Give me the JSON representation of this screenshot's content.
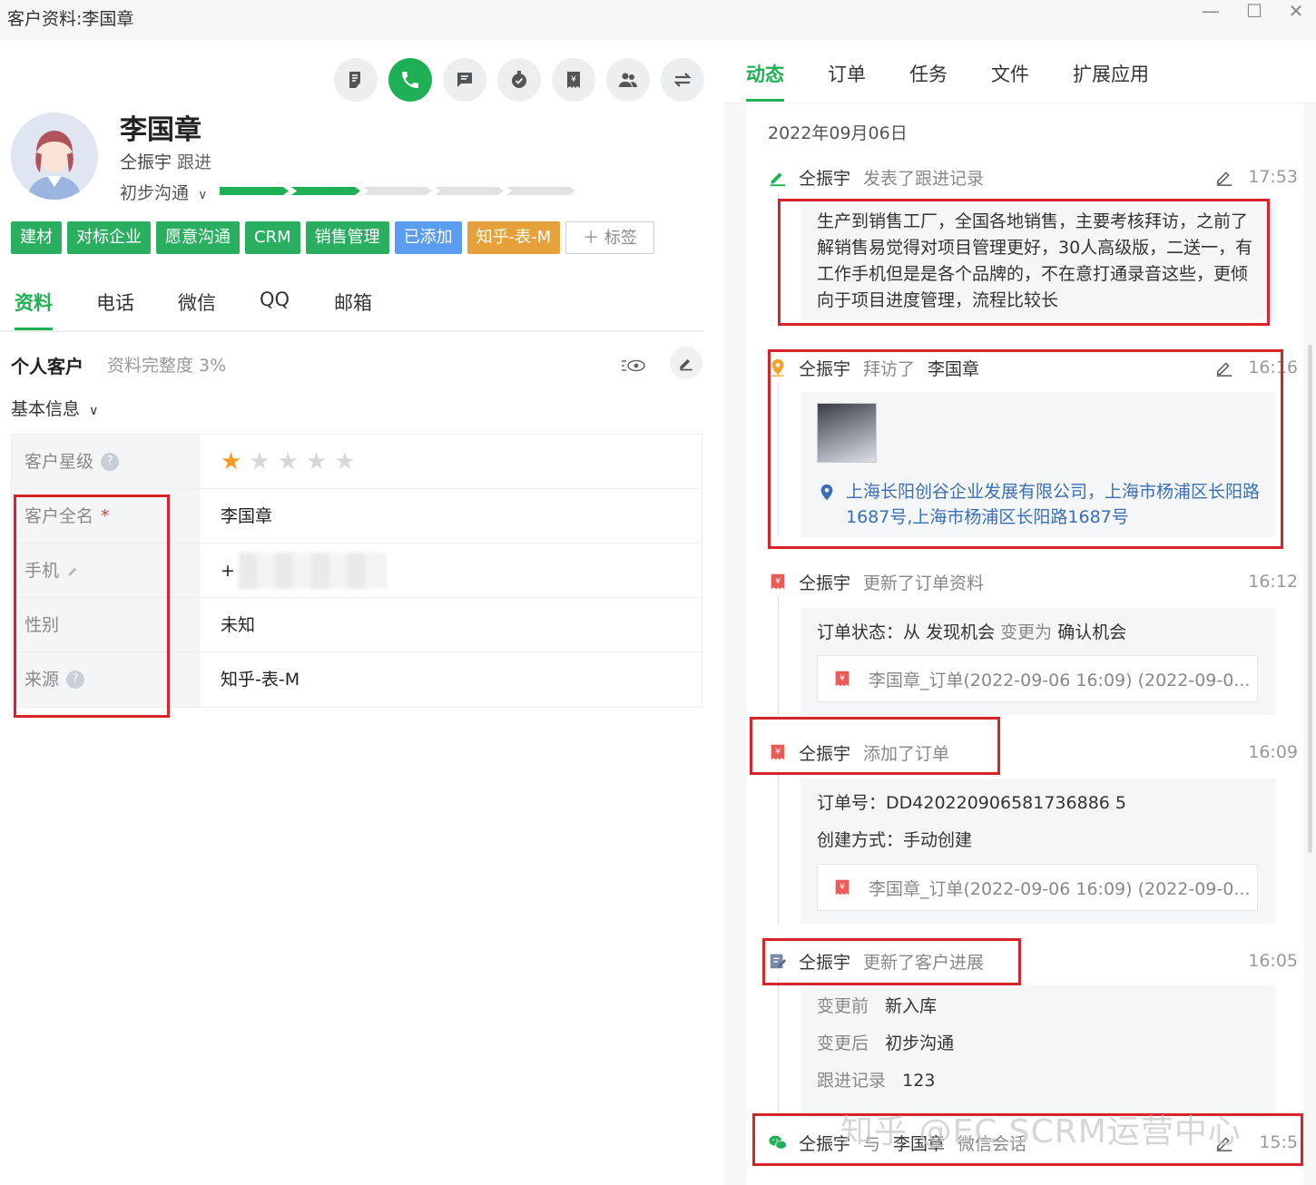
{
  "window": {
    "title": "客户资料:李国章",
    "minimize": "—",
    "maximize": "☐",
    "close": "✕"
  },
  "customer": {
    "name": "李国章",
    "owner": "仝振宇",
    "owner_action": "跟进",
    "stage": "初步沟通",
    "stage_progress": 0.4,
    "tags": [
      {
        "label": "建材",
        "color": "#2aae5f"
      },
      {
        "label": "对标企业",
        "color": "#2aae5f"
      },
      {
        "label": "愿意沟通",
        "color": "#2aae5f"
      },
      {
        "label": "CRM",
        "color": "#2aae5f"
      },
      {
        "label": "销售管理",
        "color": "#2aae5f"
      },
      {
        "label": "已添加",
        "color": "#5a9cf0"
      },
      {
        "label": "知乎-表-M",
        "color": "#e6a13a"
      }
    ],
    "add_tag_label": "＋ 标签"
  },
  "left_tabs": [
    "资料",
    "电话",
    "微信",
    "QQ",
    "邮箱"
  ],
  "profile": {
    "section_title": "个人客户",
    "completeness": "资料完整度 3%",
    "basic_info": "基本信息",
    "fields": [
      {
        "label": "客户星级",
        "value": "",
        "rating": 1,
        "max_rating": 5
      },
      {
        "label": "客户全名",
        "value": "李国章",
        "required": "*"
      },
      {
        "label": "手机",
        "value": "+"
      },
      {
        "label": "性别",
        "value": "未知"
      },
      {
        "label": "来源",
        "value": "知乎-表-M"
      }
    ]
  },
  "right_tabs": [
    "动态",
    "订单",
    "任务",
    "文件",
    "扩展应用"
  ],
  "feed": {
    "date": "2022年09月06日",
    "events": [
      {
        "user": "仝振宇",
        "action": "发表了跟进记录",
        "time": "17:53",
        "note": "生产到销售工厂，全国各地销售，主要考核拜访，之前了解销售易觉得对项目管理更好，30人高级版，二送一，有工作手机但是是各个品牌的，不在意打通录音这些，更倾向于项目进度管理，流程比较长"
      },
      {
        "user": "仝振宇",
        "action": "拜访了",
        "object": "李国章",
        "time": "16:16",
        "location": "上海长阳创谷企业发展有限公司，上海市杨浦区长阳路1687号,上海市杨浦区长阳路1687号"
      },
      {
        "user": "仝振宇",
        "action": "更新了订单资料",
        "time": "16:12",
        "status_key": "订单状态：",
        "status_from_word": "从",
        "status_from": "发现机会",
        "status_change": "变更为",
        "status_to": "确认机会",
        "order_card": "李国章_订单(2022-09-06 16:09) (2022-09-0..."
      },
      {
        "user": "仝振宇",
        "action": "添加了订单",
        "time": "16:09",
        "order_no_key": "订单号：",
        "order_no": "DD420220906581736886 5",
        "create_key": "创建方式：",
        "create_value": "手动创建",
        "order_card": "李国章_订单(2022-09-06 16:09) (2022-09-0..."
      },
      {
        "user": "仝振宇",
        "action": "更新了客户进展",
        "time": "16:05",
        "before_key": "变更前",
        "before": "新入库",
        "after_key": "变更后",
        "after": "初步沟通",
        "record_key": "跟进记录",
        "record": "123"
      },
      {
        "user": "仝振宇",
        "action": "与",
        "object": "李国章",
        "suffix": "微信会话",
        "time": "15:5"
      }
    ]
  },
  "watermark": "知乎 @EC SCRM运营中心"
}
